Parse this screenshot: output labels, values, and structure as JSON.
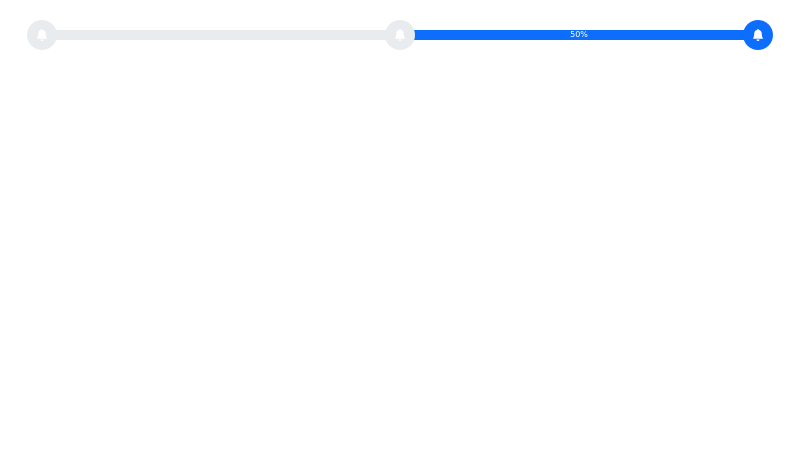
{
  "stepper": {
    "segments": [
      {
        "progress_percent": 0,
        "label": ""
      },
      {
        "progress_percent": 100,
        "label": "50%"
      }
    ],
    "steps": [
      {
        "icon": "bell-icon",
        "state": "inactive"
      },
      {
        "icon": "bell-icon",
        "state": "inactive"
      },
      {
        "icon": "bell-icon",
        "state": "active"
      }
    ]
  },
  "colors": {
    "track": "#e9ecef",
    "fill": "#0d6efd",
    "icon_inactive_bg": "#e9ecef",
    "icon_active_bg": "#0d6efd",
    "icon_glyph": "#ffffff",
    "label_text": "#ffffff"
  }
}
